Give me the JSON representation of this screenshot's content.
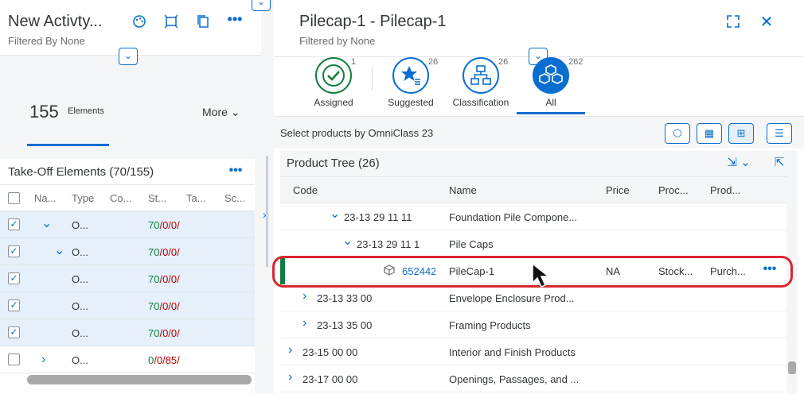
{
  "left_panel": {
    "title": "New Activty...",
    "subtitle": "Filtered By None",
    "icons": [
      "palette-icon",
      "fit-image-icon",
      "copy-icon",
      "more-icon"
    ],
    "count": "155",
    "count_label": "Elements",
    "more_label": "More",
    "takeoff_title": "Take-Off Elements (70/155)",
    "columns": [
      "Na...",
      "Type",
      "Co...",
      "St...",
      "Ta...",
      "Sc..."
    ],
    "rows": [
      {
        "checked": true,
        "expand": "down",
        "type": "O...",
        "st_g": "70",
        "st_a": "/0/0/"
      },
      {
        "checked": true,
        "expand": "down",
        "type": "O...",
        "st_g": "70",
        "st_a": "/0/0/"
      },
      {
        "checked": true,
        "expand": "",
        "type": "O...",
        "st_g": "70",
        "st_a": "/0/0/"
      },
      {
        "checked": true,
        "expand": "",
        "type": "O...",
        "st_g": "70",
        "st_a": "/0/0/"
      },
      {
        "checked": true,
        "expand": "",
        "type": "O...",
        "st_g": "70",
        "st_a": "/0/0/"
      },
      {
        "checked": false,
        "expand": "right",
        "type": "O...",
        "st_g": "0",
        "st_a": "/0/85/"
      }
    ]
  },
  "right_panel": {
    "title": "Pilecap-1 - Pilecap-1",
    "subtitle": "Filtered by None",
    "tabs": [
      {
        "label": "Assigned",
        "count": "1"
      },
      {
        "label": "Suggested",
        "count": "26"
      },
      {
        "label": "Classification",
        "count": "26"
      },
      {
        "label": "All",
        "count": "262"
      }
    ],
    "select_label": "Select products by OmniClass 23",
    "tree_title": "Product Tree (26)",
    "columns": [
      "Code",
      "Name",
      "Price",
      "Proc...",
      "Prod..."
    ],
    "rows": [
      {
        "code": "23-13 29 11 11",
        "name": "Foundation Pile Compone...",
        "price": "",
        "proc": "",
        "prod": ""
      },
      {
        "code": "23-13 29 11 1",
        "name": "Pile Caps",
        "price": "",
        "proc": "",
        "prod": ""
      },
      {
        "code": "652442",
        "name": "PileCap-1",
        "price": "NA",
        "proc": "Stock...",
        "prod": "Purch..."
      },
      {
        "code": "23-13 33 00",
        "name": "Envelope Enclosure Prod...",
        "price": "",
        "proc": "",
        "prod": ""
      },
      {
        "code": "23-13 35 00",
        "name": "Framing Products",
        "price": "",
        "proc": "",
        "prod": ""
      },
      {
        "code": "23-15 00 00",
        "name": "Interior and Finish Products",
        "price": "",
        "proc": "",
        "prod": ""
      },
      {
        "code": "23-17 00 00",
        "name": "Openings, Passages, and ...",
        "price": "",
        "proc": "",
        "prod": ""
      }
    ]
  },
  "colors": {
    "accent": "#0a6ed1",
    "success": "#107e3e",
    "error": "#bb0000",
    "highlight": "#d9272e"
  }
}
